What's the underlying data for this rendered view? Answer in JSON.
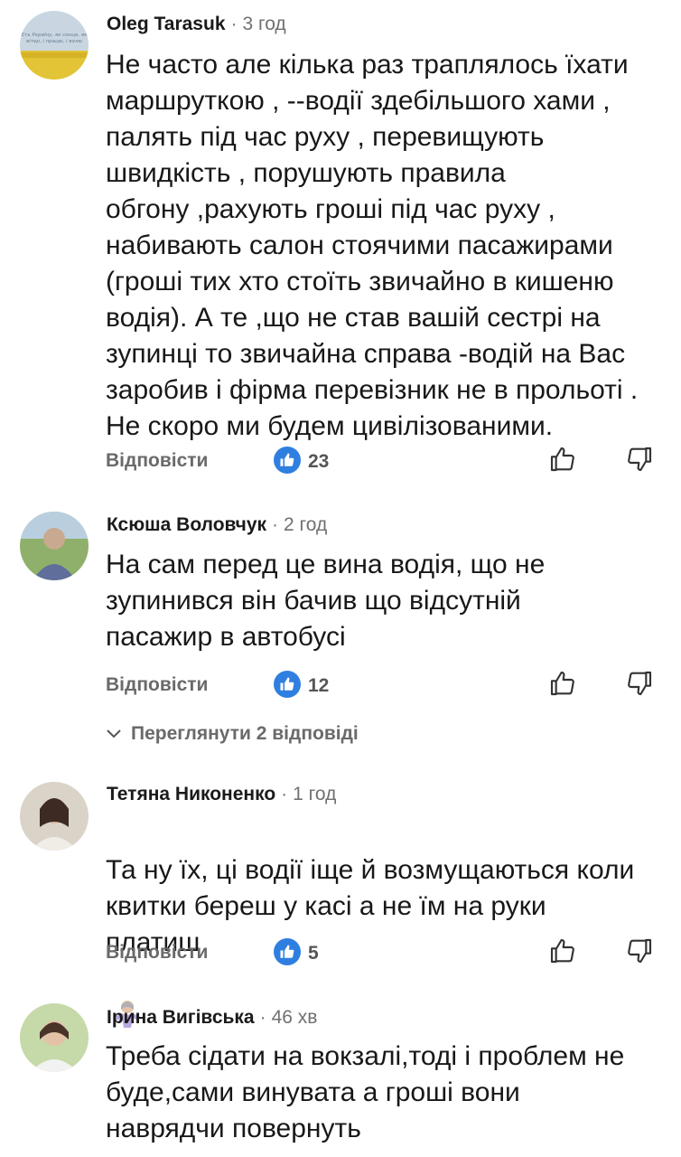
{
  "reply_label": "Відповісти",
  "comments": [
    {
      "author": "Oleg Tarasuk",
      "time": "3 год",
      "text": "Не часто але кілька раз траплялось їхати\nмаршруткою , --водії здебільшого  хами ,\nпалять під час руху , перевищують\nшвидкість , порушують правила\nобгону ,рахують гроші під час руху ,\nнабивають салон стоячими пасажирами\n(гроші тих хто стоїть звичайно в кишеню\nводія). А те ,що не став вашій сестрі на\nзупинці то звичайна справа -водій на Вас\nзаробив і фірма перевізник не в прольоті .\nНе скоро ми будем цивілізованими.",
      "likes": "23",
      "avatar_text": "Єть Україну, як сонце, як вітер, і працю, і волю"
    },
    {
      "author": "Ксюша Воловчук",
      "time": "2 год",
      "text": "На сам перед це вина водія, що не\nзупинився він бачив що відсутній\nпасажир в автобусі",
      "likes": "12"
    },
    {
      "author": "Тетяна Никоненко",
      "time": "1 год",
      "text": "Та ну їх, ці водії іще й возмущаються коли\nквитки береш у касі а не їм на руки\nплатиш",
      "likes": "5"
    },
    {
      "author": "Ірина Вигівська",
      "time": "46 хв",
      "text": "Треба сідати на вокзалі,тоді і проблем не\nбуде,сами винувата а гроші вони\nнаврядчи повернуть"
    }
  ],
  "show_replies": "Переглянути 2 відповіді",
  "colors": {
    "like_badge": "#2f7fe0",
    "secondary_text": "#6a6a6a"
  },
  "icons": [
    "like-badge-icon",
    "thumbs-up-icon",
    "thumbs-down-icon",
    "chevron-down-icon",
    "shrug-emoji-icon"
  ]
}
